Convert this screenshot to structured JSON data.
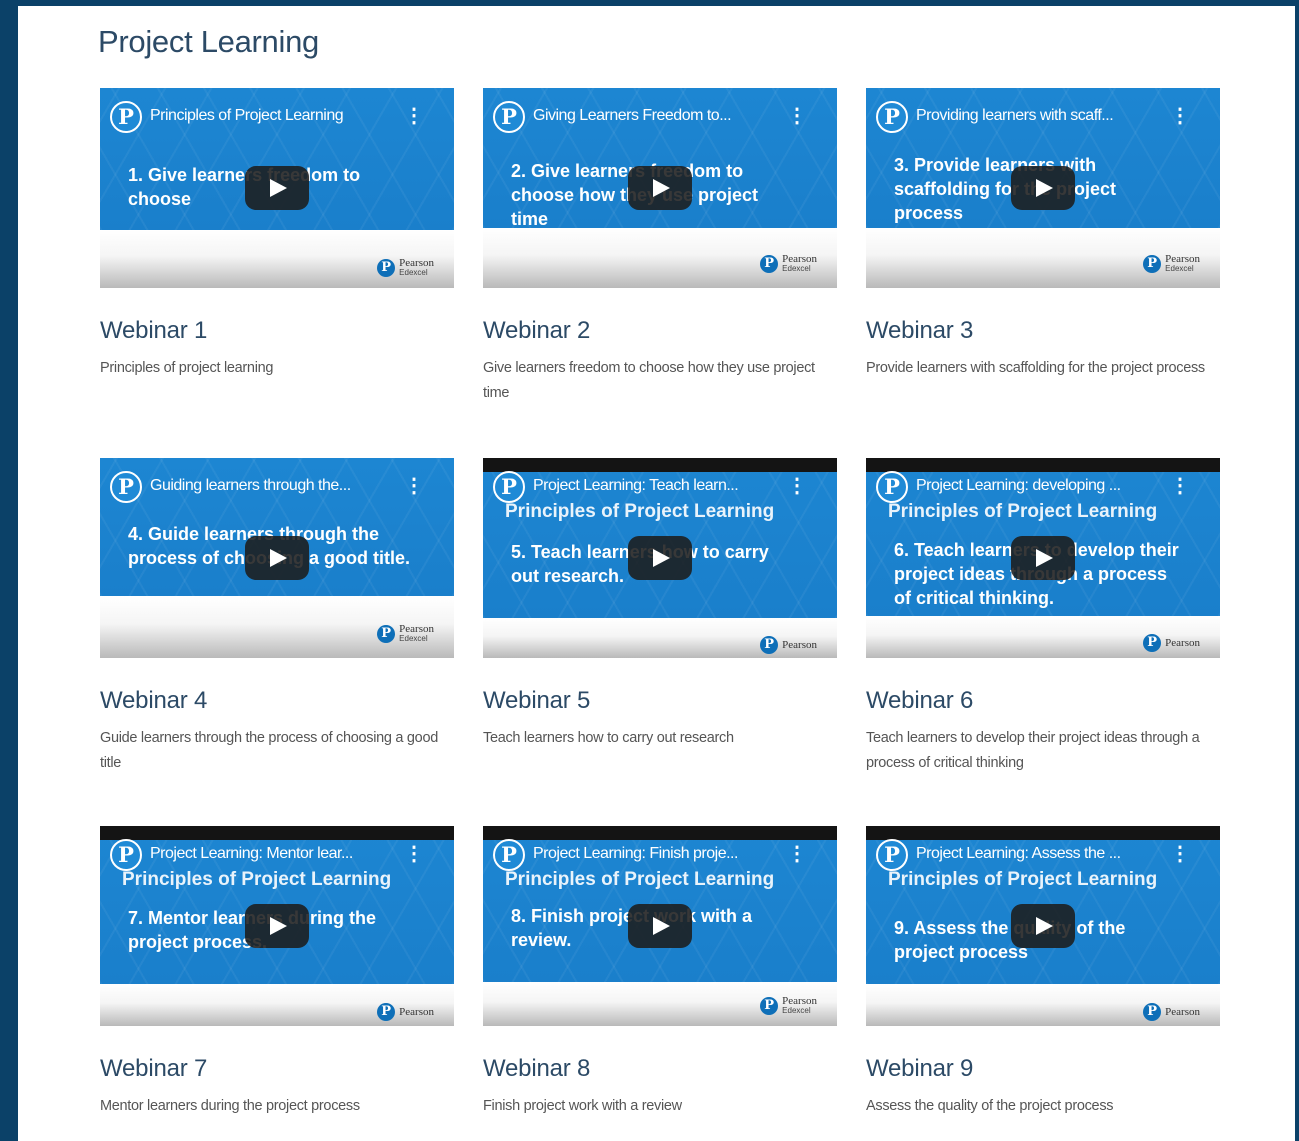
{
  "title": "Project Learning",
  "logo_letter": "P",
  "menu_glyph": "⋮",
  "brand": {
    "name": "Pearson",
    "sub": "Edexcel"
  },
  "webinars": [
    {
      "video_title": "Principles of Project Learning",
      "video_subtitle": "",
      "slide": "1. Give learners freedom to choose",
      "heading": "Webinar 1",
      "description": "Principles of project learning"
    },
    {
      "video_title": "Giving Learners Freedom to...",
      "video_subtitle": "",
      "slide": "2. Give learners freedom to choose how they use project time",
      "heading": "Webinar 2",
      "description": "Give learners freedom to choose how they use project time"
    },
    {
      "video_title": "Providing learners with scaff...",
      "video_subtitle": "",
      "slide": "3. Provide learners with scaffolding for the project process",
      "heading": "Webinar 3",
      "description": "Provide learners with scaffolding for the project process"
    },
    {
      "video_title": "Guiding learners through the...",
      "video_subtitle": "",
      "slide": "4. Guide learners through the process of choosing a good title.",
      "heading": "Webinar 4",
      "description": "Guide learners through the process of choosing a good title"
    },
    {
      "video_title": "Project Learning: Teach learn...",
      "video_subtitle": "Principles of Project Learning",
      "slide": "5. Teach learners how to carry out research.",
      "heading": "Webinar 5",
      "description": "Teach learners how to carry out research"
    },
    {
      "video_title": "Project Learning: developing ...",
      "video_subtitle": "Principles of Project Learning",
      "slide": "6. Teach learners to develop their project ideas through a process of critical thinking.",
      "heading": "Webinar 6",
      "description": "Teach learners to develop their project ideas through a process of critical thinking"
    },
    {
      "video_title": "Project Learning: Mentor lear...",
      "video_subtitle": "Principles of Project Learning",
      "slide": "7. Mentor learners during the project process.",
      "heading": "Webinar 7",
      "description": "Mentor learners during the project process"
    },
    {
      "video_title": "Project Learning: Finish proje...",
      "video_subtitle": "Principles of Project Learning",
      "slide": "8. Finish project work with a review.",
      "heading": "Webinar 8",
      "description": "Finish project work with a review"
    },
    {
      "video_title": "Project Learning: Assess the ...",
      "video_subtitle": "Principles of Project Learning",
      "slide": "9. Assess the quality of the project process",
      "heading": "Webinar 9",
      "description": "Assess the quality of the project process"
    }
  ]
}
